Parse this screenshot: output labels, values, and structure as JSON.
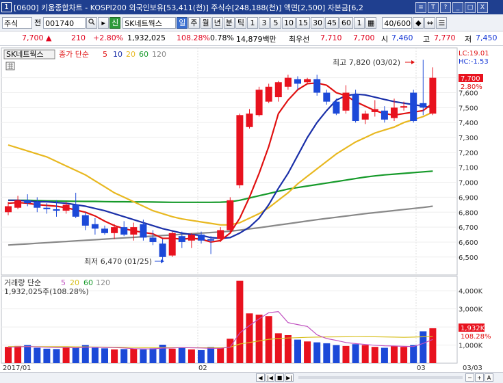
{
  "window": {
    "num": "1",
    "title": "[0600] 키움종합차트 - KOSPI200 외국인보유[53,411(천)] 주식수[248,188(천)] 액면[2,500] 자본금[6,2",
    "buttons": [
      "≡",
      "T",
      "?",
      "_",
      "□",
      "X"
    ]
  },
  "toolbar": {
    "market": "주식",
    "jeon": "전",
    "code": "001740",
    "search_icon": "search-icon",
    "new_badge": "신",
    "stock_name": "SK네트웍스",
    "periods": [
      "일",
      "주",
      "월",
      "년",
      "분",
      "틱",
      "1",
      "3",
      "5",
      "10",
      "15",
      "30",
      "45",
      "60",
      "1"
    ],
    "count": "40/600"
  },
  "quote": {
    "price": "7,700",
    "change": "210",
    "change_pct": "+2.80%",
    "volume": "1,932,025",
    "vol_ratio": "108.28%",
    "turnover": "0.78%",
    "amount": "14,879백만",
    "pref_label": "최우선",
    "pref1": "7,710",
    "pref2": "7,700",
    "open_label": "시",
    "open": "7,460",
    "high_label": "고",
    "high": "7,770",
    "low_label": "저",
    "low": "7,450"
  },
  "legend": {
    "stock": "SK네트웍스",
    "ma_label": "종가 단순",
    "ma_periods": [
      "5",
      "10",
      "20",
      "60",
      "120"
    ],
    "vol_label": "거래량 단순",
    "vol_periods": [
      "5",
      "20",
      "60",
      "120"
    ],
    "vol_value": "1,932,025주(108.28%)"
  },
  "annotations": {
    "high": "최고 7,820 (03/02)",
    "low": "최저 6,470 (01/25)",
    "lc": "LC:19.01",
    "hc": "HC:-1.53",
    "price_tag": "7,700",
    "pct_tag": "2.80%",
    "vol_tag": "1,932K",
    "vol_pct_tag": "108.28%"
  },
  "x_labels": {
    "start": "2017/01",
    "feb": "02",
    "mar": "03",
    "right": "03/03"
  },
  "colors": {
    "up": "#e8121e",
    "down": "#1c49d8",
    "ma5": "#e01010",
    "ma10": "#1a2fa8",
    "ma20": "#e8b820",
    "ma60": "#169a2a",
    "ma120": "#888888",
    "vma5": "#c050c0",
    "vma20": "#d8c020"
  },
  "chart_data": {
    "type": "candlestick",
    "price_axis": {
      "ticks": [
        6500,
        6600,
        6700,
        6800,
        6900,
        7000,
        7100,
        7200,
        7300,
        7400,
        7500,
        7600,
        7700
      ],
      "labels": [
        "6,500",
        "6,600",
        "6,700",
        "6,800",
        "6,900",
        "7,000",
        "7,100",
        "7,200",
        "7,300",
        "7,400",
        "7,500",
        "7,600",
        "7,700"
      ],
      "min": 6380,
      "max": 7900
    },
    "volume_axis": {
      "ticks": [
        1000000,
        2000000,
        3000000,
        4000000
      ],
      "labels": [
        "1,000K",
        "2,000K",
        "3,000K",
        "4,000K"
      ],
      "max": 4800000
    },
    "candles": [
      {
        "o": 6800,
        "h": 6870,
        "l": 6780,
        "c": 6840
      },
      {
        "o": 6830,
        "h": 6910,
        "l": 6820,
        "c": 6880
      },
      {
        "o": 6880,
        "h": 6920,
        "l": 6840,
        "c": 6860
      },
      {
        "o": 6870,
        "h": 6900,
        "l": 6800,
        "c": 6830
      },
      {
        "o": 6830,
        "h": 6860,
        "l": 6790,
        "c": 6820
      },
      {
        "o": 6820,
        "h": 6880,
        "l": 6770,
        "c": 6810
      },
      {
        "o": 6810,
        "h": 6870,
        "l": 6790,
        "c": 6850
      },
      {
        "o": 6850,
        "h": 6930,
        "l": 6760,
        "c": 6770
      },
      {
        "o": 6780,
        "h": 6800,
        "l": 6680,
        "c": 6710
      },
      {
        "o": 6720,
        "h": 6760,
        "l": 6650,
        "c": 6690
      },
      {
        "o": 6690,
        "h": 6710,
        "l": 6650,
        "c": 6660
      },
      {
        "o": 6660,
        "h": 6720,
        "l": 6620,
        "c": 6700
      },
      {
        "o": 6700,
        "h": 6740,
        "l": 6640,
        "c": 6650
      },
      {
        "o": 6650,
        "h": 6730,
        "l": 6610,
        "c": 6700
      },
      {
        "o": 6720,
        "h": 6750,
        "l": 6610,
        "c": 6630
      },
      {
        "o": 6630,
        "h": 6680,
        "l": 6580,
        "c": 6600
      },
      {
        "o": 6590,
        "h": 6620,
        "l": 6470,
        "c": 6500
      },
      {
        "o": 6510,
        "h": 6670,
        "l": 6500,
        "c": 6660
      },
      {
        "o": 6640,
        "h": 6670,
        "l": 6560,
        "c": 6600
      },
      {
        "o": 6610,
        "h": 6660,
        "l": 6560,
        "c": 6650
      },
      {
        "o": 6650,
        "h": 6670,
        "l": 6590,
        "c": 6610
      },
      {
        "o": 6620,
        "h": 6640,
        "l": 6520,
        "c": 6610
      },
      {
        "o": 6620,
        "h": 6700,
        "l": 6600,
        "c": 6680
      },
      {
        "o": 6680,
        "h": 6900,
        "l": 6660,
        "c": 6880
      },
      {
        "o": 6980,
        "h": 7460,
        "l": 6960,
        "c": 7450
      },
      {
        "o": 7370,
        "h": 7490,
        "l": 7360,
        "c": 7460
      },
      {
        "o": 7450,
        "h": 7640,
        "l": 7440,
        "c": 7620
      },
      {
        "o": 7540,
        "h": 7660,
        "l": 7530,
        "c": 7640
      },
      {
        "o": 7570,
        "h": 7680,
        "l": 7540,
        "c": 7670
      },
      {
        "o": 7640,
        "h": 7720,
        "l": 7620,
        "c": 7700
      },
      {
        "o": 7690,
        "h": 7710,
        "l": 7620,
        "c": 7660
      },
      {
        "o": 7670,
        "h": 7700,
        "l": 7660,
        "c": 7690
      },
      {
        "o": 7690,
        "h": 7720,
        "l": 7580,
        "c": 7600
      },
      {
        "o": 7600,
        "h": 7620,
        "l": 7520,
        "c": 7540
      },
      {
        "o": 7540,
        "h": 7560,
        "l": 7450,
        "c": 7460
      },
      {
        "o": 7480,
        "h": 7650,
        "l": 7460,
        "c": 7600
      },
      {
        "o": 7590,
        "h": 7620,
        "l": 7400,
        "c": 7410
      },
      {
        "o": 7420,
        "h": 7480,
        "l": 7390,
        "c": 7460
      },
      {
        "o": 7470,
        "h": 7550,
        "l": 7440,
        "c": 7490
      },
      {
        "o": 7480,
        "h": 7510,
        "l": 7400,
        "c": 7420
      },
      {
        "o": 7430,
        "h": 7560,
        "l": 7410,
        "c": 7500
      },
      {
        "o": 7500,
        "h": 7540,
        "l": 7480,
        "c": 7510
      },
      {
        "o": 7600,
        "h": 7620,
        "l": 7400,
        "c": 7410
      },
      {
        "o": 7530,
        "h": 7820,
        "l": 7450,
        "c": 7500
      },
      {
        "o": 7460,
        "h": 7770,
        "l": 7450,
        "c": 7700
      }
    ],
    "volumes": [
      900000,
      950000,
      1000000,
      850000,
      800000,
      780000,
      900000,
      870000,
      1000000,
      850000,
      820000,
      760000,
      780000,
      800000,
      760000,
      820000,
      1020000,
      800000,
      880000,
      760000,
      720000,
      900000,
      850000,
      1350000,
      4550000,
      2750000,
      2680000,
      2600000,
      1650000,
      1550000,
      1300000,
      1200000,
      1150000,
      1100000,
      1000000,
      950000,
      1050000,
      1000000,
      900000,
      850000,
      950000,
      900000,
      1000000,
      1760000,
      1930000
    ],
    "ma5": [
      6860,
      6865,
      6860,
      6850,
      6845,
      6840,
      6830,
      6815,
      6800,
      6775,
      6740,
      6710,
      6690,
      6675,
      6665,
      6655,
      6625,
      6625,
      6620,
      6625,
      6620,
      6600,
      6610,
      6660,
      6760,
      6900,
      7060,
      7240,
      7460,
      7550,
      7620,
      7660,
      7665,
      7650,
      7600,
      7580,
      7540,
      7510,
      7480,
      7460,
      7450,
      7460,
      7470,
      7480,
      7530
    ],
    "ma10": [
      6880,
      6880,
      6875,
      6870,
      6870,
      6865,
      6860,
      6850,
      6840,
      6825,
      6810,
      6790,
      6770,
      6750,
      6730,
      6710,
      6690,
      6675,
      6660,
      6650,
      6645,
      6630,
      6625,
      6630,
      6660,
      6700,
      6760,
      6850,
      6960,
      7060,
      7180,
      7300,
      7400,
      7480,
      7550,
      7580,
      7590,
      7585,
      7570,
      7555,
      7540,
      7530,
      7520,
      7510,
      7500
    ],
    "ma20": [
      7250,
      7230,
      7210,
      7190,
      7170,
      7140,
      7110,
      7080,
      7050,
      7010,
      6970,
      6930,
      6900,
      6870,
      6840,
      6810,
      6790,
      6770,
      6755,
      6745,
      6735,
      6725,
      6715,
      6715,
      6730,
      6760,
      6790,
      6830,
      6880,
      6930,
      6990,
      7040,
      7090,
      7140,
      7190,
      7230,
      7270,
      7300,
      7330,
      7350,
      7370,
      7400,
      7420,
      7440,
      7470
    ],
    "ma60": [
      6880,
      6880,
      6880,
      6878,
      6876,
      6875,
      6874,
      6873,
      6872,
      6872,
      6871,
      6870,
      6870,
      6869,
      6869,
      6868,
      6867,
      6866,
      6866,
      6866,
      6866,
      6866,
      6867,
      6870,
      6880,
      6895,
      6910,
      6925,
      6940,
      6955,
      6965,
      6975,
      6985,
      6995,
      7005,
      7015,
      7025,
      7035,
      7043,
      7050,
      7055,
      7060,
      7065,
      7070,
      7075
    ],
    "ma120": [
      6580,
      6584,
      6588,
      6592,
      6596,
      6600,
      6604,
      6608,
      6612,
      6616,
      6620,
      6624,
      6628,
      6632,
      6636,
      6640,
      6644,
      6648,
      6652,
      6656,
      6660,
      6664,
      6668,
      6673,
      6680,
      6688,
      6696,
      6705,
      6714,
      6723,
      6732,
      6741,
      6750,
      6758,
      6766,
      6774,
      6782,
      6790,
      6797,
      6804,
      6811,
      6818,
      6825,
      6832,
      6840
    ],
    "vma5": [
      880000,
      900000,
      920000,
      900000,
      880000,
      870000,
      860000,
      850000,
      880000,
      880000,
      870000,
      860000,
      840000,
      800000,
      790000,
      790000,
      830000,
      840000,
      860000,
      850000,
      840000,
      820000,
      820000,
      890000,
      1670000,
      2080000,
      2450000,
      2790000,
      2850000,
      2240000,
      2130000,
      2030000,
      1570000,
      1360000,
      1260000,
      1140000,
      1080000,
      1030000,
      990000,
      960000,
      950000,
      930000,
      920000,
      1090000,
      1310000
    ],
    "vma20": [
      920000,
      920000,
      918000,
      916000,
      914000,
      912000,
      910000,
      905000,
      900000,
      895000,
      890000,
      885000,
      880000,
      875000,
      870000,
      865000,
      862000,
      860000,
      858000,
      856000,
      855000,
      855000,
      855000,
      880000,
      1060000,
      1140000,
      1230000,
      1320000,
      1360000,
      1390000,
      1410000,
      1430000,
      1440000,
      1450000,
      1455000,
      1460000,
      1465000,
      1470000,
      1460000,
      1450000,
      1440000,
      1430000,
      1440000,
      1460000,
      1480000
    ]
  }
}
